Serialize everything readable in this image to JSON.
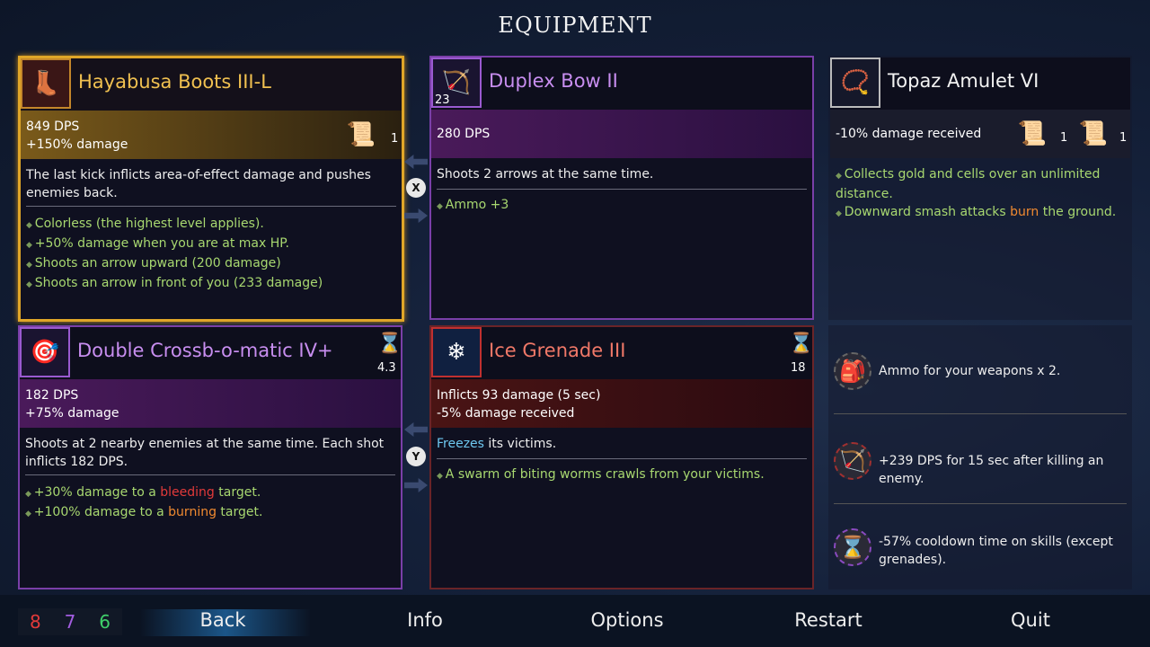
{
  "title": "EQUIPMENT",
  "items": {
    "boots": {
      "name": "Hayabusa Boots III-L",
      "stat1": "849 DPS",
      "stat2": "+150% damage",
      "scroll_count": "1",
      "desc": "The last kick inflicts area-of-effect damage and pushes enemies back.",
      "affixes": [
        "Colorless (the highest level applies).",
        "+50% damage when you are at max HP.",
        "Shoots an arrow upward (200 damage)",
        "Shoots an arrow in front of you (233 damage)"
      ]
    },
    "bow": {
      "name": "Duplex Bow II",
      "ammo": "23",
      "stat1": "280 DPS",
      "desc": "Shoots 2 arrows at the same time.",
      "affixes": [
        "Ammo +3"
      ]
    },
    "amulet": {
      "name": "Topaz Amulet VI",
      "stat1": "-10% damage received",
      "scroll1_count": "1",
      "scroll2_count": "1",
      "affixes": [
        "Collects gold and cells over an unlimited distance.",
        "Downward smash attacks ",
        "burn",
        " the ground."
      ]
    },
    "crossbow": {
      "name": "Double Crossb-o-matic IV+",
      "cooldown": "4.3",
      "stat1": "182 DPS",
      "stat2": "+75% damage",
      "desc": "Shoots at 2 nearby enemies at the same time. Each shot inflicts 182 DPS.",
      "affix1_a": "+30% damage to a ",
      "affix1_b": "bleeding",
      "affix1_c": " target.",
      "affix2_a": "+100% damage to a ",
      "affix2_b": "burning",
      "affix2_c": " target."
    },
    "grenade": {
      "name": "Ice Grenade III",
      "cooldown": "18",
      "stat1": "Inflicts 93 damage (5 sec)",
      "stat2": "-5% damage received",
      "desc_a": "Freezes",
      "desc_b": " its victims.",
      "affixes": [
        "A swarm of biting worms crawls from your victims."
      ]
    }
  },
  "controls": {
    "x": "X",
    "y": "Y"
  },
  "mutations": [
    "Ammo for your weapons x 2.",
    "+239 DPS for 15 sec after killing an enemy.",
    "-57% cooldown time on skills (except grenades)."
  ],
  "scrolls": {
    "brutality": "8",
    "tactics": "7",
    "survival": "6"
  },
  "menu": {
    "back": "Back",
    "info": "Info",
    "options": "Options",
    "restart": "Restart",
    "quit": "Quit"
  },
  "colors": {
    "brutality": "#e23a3a",
    "tactics": "#a35de0",
    "survival": "#3fcf6a",
    "gold": "#e0a628"
  }
}
